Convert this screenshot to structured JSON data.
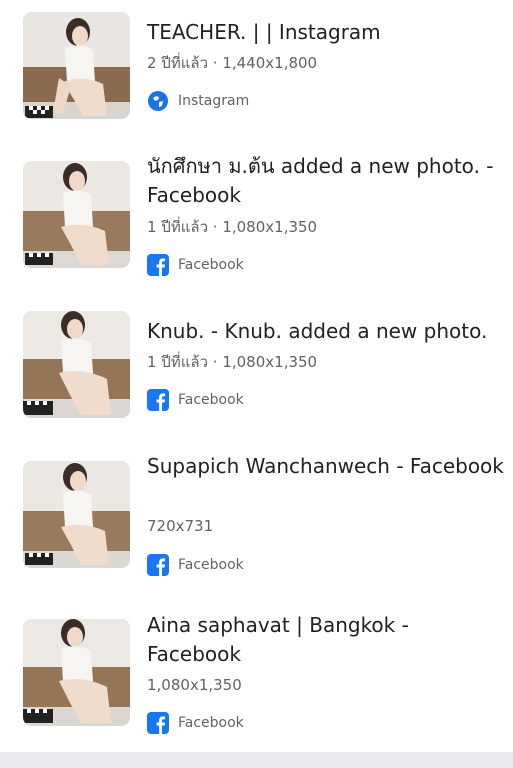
{
  "results": [
    {
      "title": "TEACHER. | | Instagram",
      "time_ago": "2 ปีที่แล้ว",
      "dimensions": "1,440x1,800",
      "source": "Instagram",
      "source_icon": "globe-icon"
    },
    {
      "title": "นักศึกษา ม.ต้น added a new photo. - Facebook",
      "time_ago": "1 ปีที่แล้ว",
      "dimensions": "1,080x1,350",
      "source": "Facebook",
      "source_icon": "facebook-icon"
    },
    {
      "title": "Knub. - Knub. added a new photo.",
      "time_ago": "1 ปีที่แล้ว",
      "dimensions": "1,080x1,350",
      "source": "Facebook",
      "source_icon": "facebook-icon"
    },
    {
      "title": "Supapich Wanchanwech - Facebook",
      "dimensions": "720x731",
      "source": "Facebook",
      "source_icon": "facebook-icon"
    },
    {
      "title": "Aina saphavat | Bangkok - Facebook",
      "dimensions": "1,080x1,350",
      "source": "Facebook",
      "source_icon": "facebook-icon"
    }
  ],
  "meta_separator": " · ",
  "colors": {
    "title": "#202124",
    "meta": "#5f6368",
    "facebook": "#1877f2",
    "globe": "#1a73e8",
    "bottom_bar": "#e8eaed"
  }
}
